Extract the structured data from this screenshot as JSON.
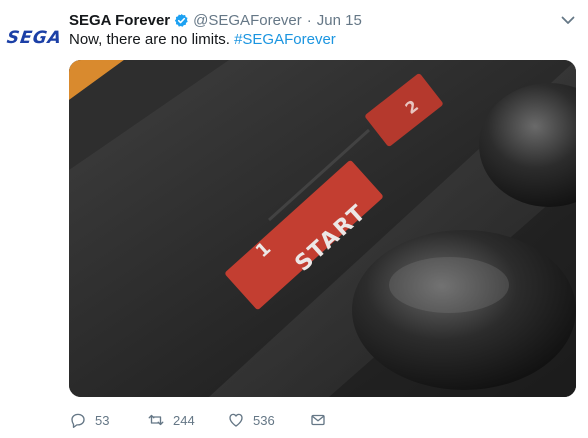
{
  "tweet": {
    "account": {
      "avatar_text": "SEGA",
      "display_name": "SEGA Forever",
      "handle": "@SEGAForever",
      "separator": "·",
      "date": "Jun 15",
      "verified": true
    },
    "text": "Now, there are no limits.",
    "hashtag": "#SEGAForever",
    "media": {
      "button_labels": [
        "1",
        "START",
        "2"
      ]
    },
    "actions": {
      "replies": "53",
      "retweets": "244",
      "likes": "536"
    }
  },
  "colors": {
    "brand_blue": "#1b3fa6",
    "link_blue": "#1b95e0",
    "muted_gray": "#657786",
    "verified_blue": "#1da1f2"
  },
  "icons": {
    "verified": "verified-badge-icon",
    "caret": "chevron-down-icon",
    "reply": "reply-icon",
    "retweet": "retweet-icon",
    "like": "heart-icon",
    "message": "envelope-icon"
  }
}
